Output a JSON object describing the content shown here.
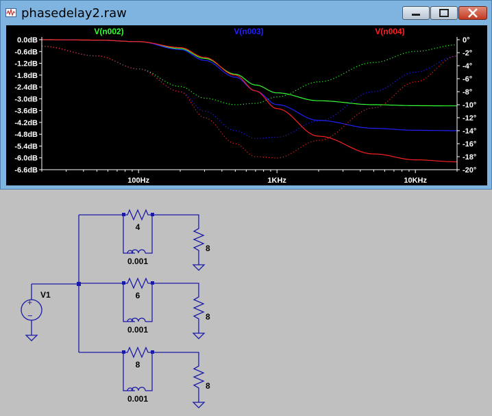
{
  "window": {
    "title": "phasedelay2.raw",
    "icon": "waveform-icon"
  },
  "window_controls": {
    "minimize_icon": "minimize-icon",
    "maximize_icon": "maximize-icon",
    "close_icon": "close-icon"
  },
  "colors": {
    "plot_bg": "#000000",
    "axis": "#ffffff",
    "v_n002": "#33ff33",
    "v_n003": "#2020ff",
    "v_n004": "#ff2020",
    "wire": "#1a1aa8",
    "canvas": "#c0c0c0"
  },
  "chart_data": {
    "type": "line",
    "x_scale": "log",
    "xlim": [
      20,
      20000
    ],
    "x_ticks": [
      {
        "v": 100,
        "label": "100Hz"
      },
      {
        "v": 1000,
        "label": "1KHz"
      },
      {
        "v": 10000,
        "label": "10KHz"
      }
    ],
    "y_left_ticks": [
      "0.0dB",
      "-0.6dB",
      "-1.2dB",
      "-1.8dB",
      "-2.4dB",
      "-3.0dB",
      "-3.6dB",
      "-4.2dB",
      "-4.8dB",
      "-5.4dB",
      "-6.0dB",
      "-6.6dB"
    ],
    "y_left_range": [
      -6.6,
      0
    ],
    "y_right_ticks": [
      "0°",
      "-2°",
      "-4°",
      "-6°",
      "-8°",
      "-10°",
      "-12°",
      "-14°",
      "-16°",
      "-18°",
      "-20°"
    ],
    "y_right_range": [
      -20,
      0
    ],
    "series": [
      {
        "name": "V(n002)",
        "color": "#33ff33",
        "magnitude_db": [
          [
            20,
            0
          ],
          [
            50,
            -0.02
          ],
          [
            100,
            -0.1
          ],
          [
            200,
            -0.45
          ],
          [
            300,
            -0.95
          ],
          [
            500,
            -1.75
          ],
          [
            700,
            -2.3
          ],
          [
            1000,
            -2.7
          ],
          [
            2000,
            -3.1
          ],
          [
            5000,
            -3.3
          ],
          [
            10000,
            -3.35
          ],
          [
            20000,
            -3.36
          ]
        ],
        "phase_deg": [
          [
            20,
            -1
          ],
          [
            50,
            -2.5
          ],
          [
            100,
            -4.5
          ],
          [
            200,
            -7.2
          ],
          [
            300,
            -9
          ],
          [
            500,
            -10
          ],
          [
            700,
            -9.8
          ],
          [
            1000,
            -8.8
          ],
          [
            2000,
            -6.5
          ],
          [
            5000,
            -3.5
          ],
          [
            10000,
            -1.8
          ],
          [
            20000,
            -0.8
          ]
        ]
      },
      {
        "name": "V(n003)",
        "color": "#2020ff",
        "magnitude_db": [
          [
            20,
            0
          ],
          [
            50,
            -0.02
          ],
          [
            100,
            -0.1
          ],
          [
            200,
            -0.5
          ],
          [
            300,
            -1.05
          ],
          [
            500,
            -1.9
          ],
          [
            700,
            -2.6
          ],
          [
            1000,
            -3.3
          ],
          [
            2000,
            -4.1
          ],
          [
            5000,
            -4.5
          ],
          [
            10000,
            -4.6
          ],
          [
            20000,
            -4.62
          ]
        ],
        "phase_deg": [
          [
            20,
            -1
          ],
          [
            50,
            -2.5
          ],
          [
            100,
            -4.5
          ],
          [
            200,
            -8
          ],
          [
            300,
            -11
          ],
          [
            500,
            -14
          ],
          [
            700,
            -15.2
          ],
          [
            1000,
            -15
          ],
          [
            2000,
            -12.5
          ],
          [
            5000,
            -8
          ],
          [
            10000,
            -5
          ],
          [
            20000,
            -2.5
          ]
        ]
      },
      {
        "name": "V(n004)",
        "color": "#ff2020",
        "magnitude_db": [
          [
            20,
            0
          ],
          [
            50,
            -0.02
          ],
          [
            100,
            -0.1
          ],
          [
            200,
            -0.4
          ],
          [
            300,
            -0.9
          ],
          [
            500,
            -1.8
          ],
          [
            700,
            -2.6
          ],
          [
            1000,
            -3.5
          ],
          [
            2000,
            -4.9
          ],
          [
            5000,
            -5.8
          ],
          [
            10000,
            -6.1
          ],
          [
            20000,
            -6.2
          ]
        ],
        "phase_deg": [
          [
            20,
            -1
          ],
          [
            50,
            -2.5
          ],
          [
            100,
            -4.5
          ],
          [
            200,
            -8
          ],
          [
            300,
            -12
          ],
          [
            500,
            -16
          ],
          [
            700,
            -18
          ],
          [
            1000,
            -18.2
          ],
          [
            2000,
            -15.5
          ],
          [
            5000,
            -10.5
          ],
          [
            10000,
            -6.5
          ],
          [
            20000,
            -2.5
          ]
        ]
      }
    ]
  },
  "schematic": {
    "source_label": "V1",
    "branches": [
      {
        "resistor": "4",
        "inductor": "0.001",
        "load": "8"
      },
      {
        "resistor": "6",
        "inductor": "0.001",
        "load": "8"
      },
      {
        "resistor": "8",
        "inductor": "0.001",
        "load": "8"
      }
    ]
  }
}
